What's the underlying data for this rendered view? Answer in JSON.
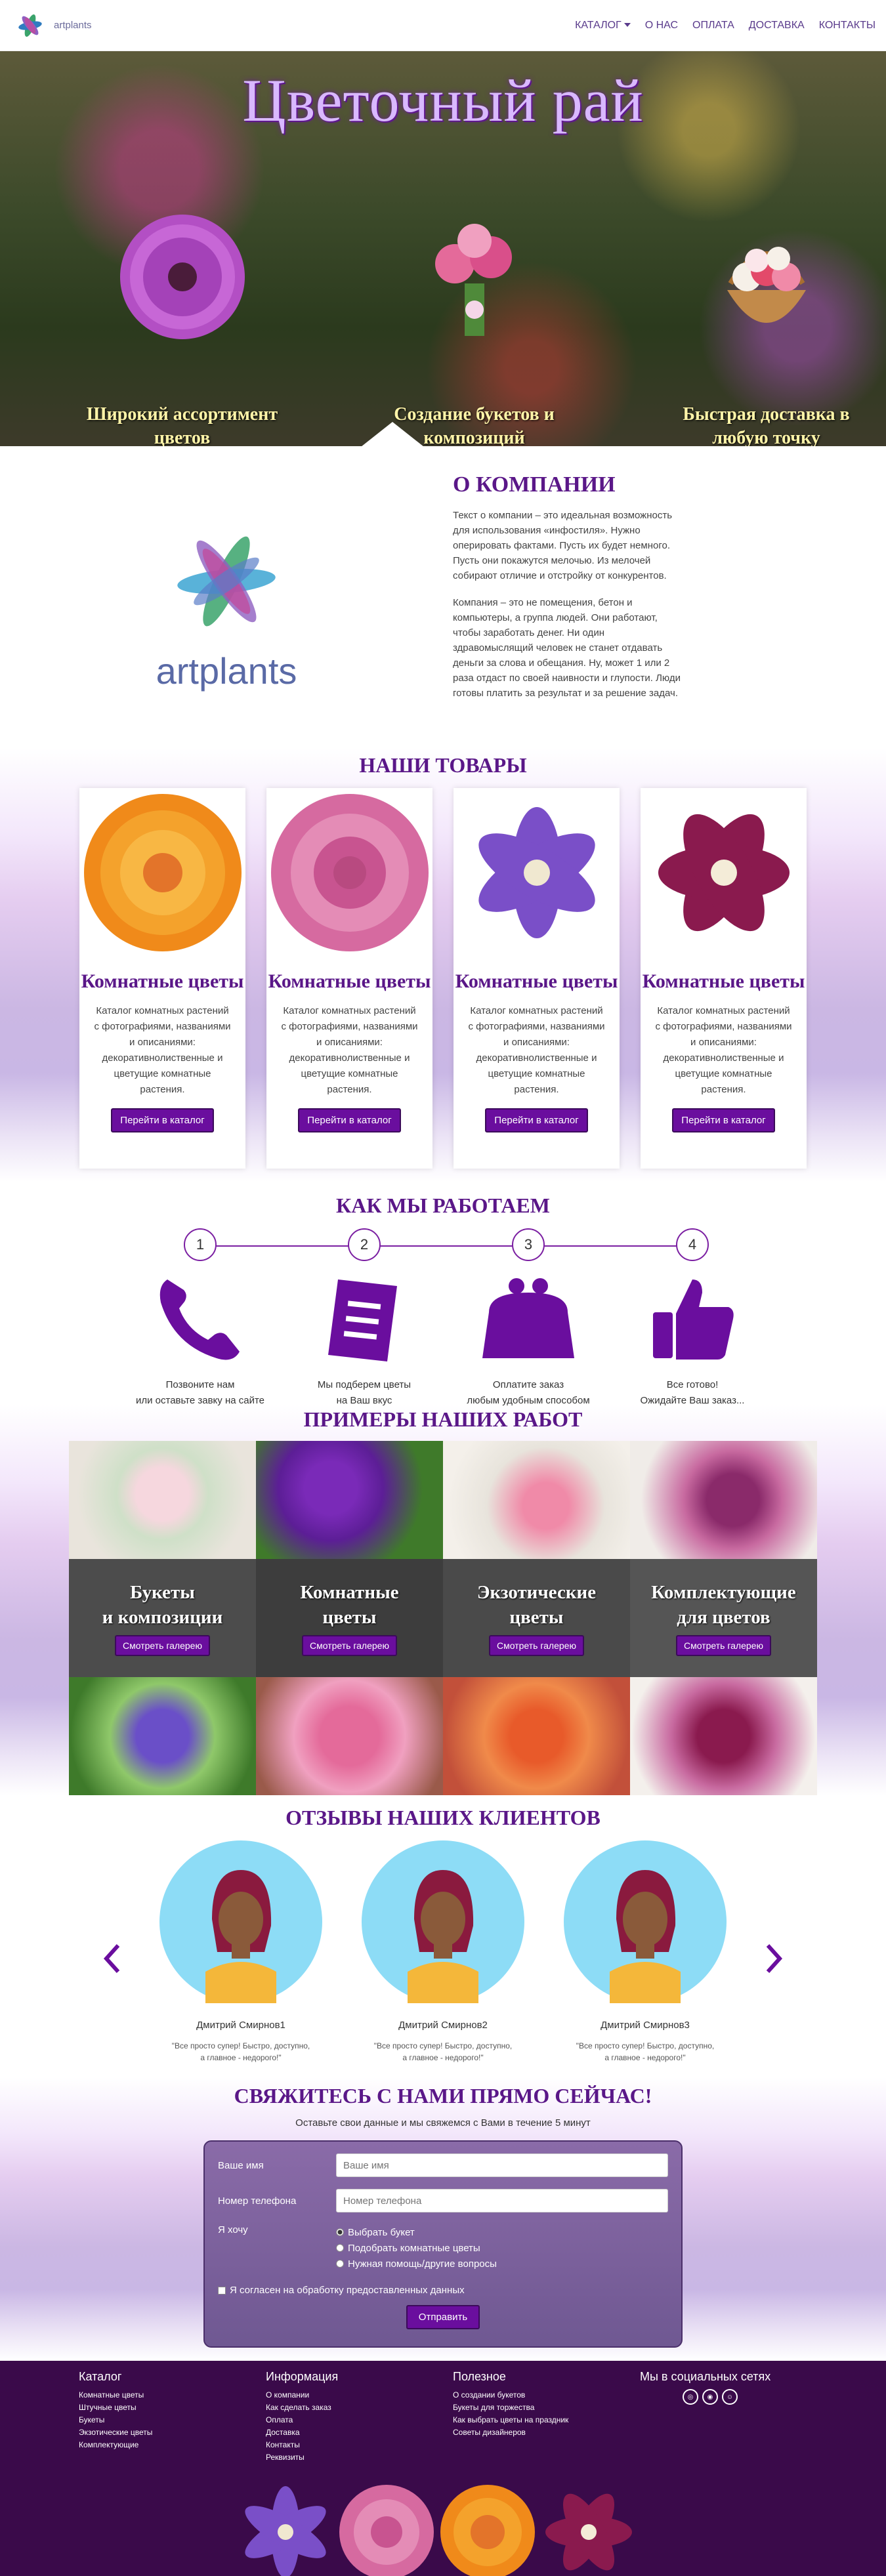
{
  "nav": {
    "brand": "artplants",
    "items": [
      "КАТАЛОГ",
      "О НАС",
      "ОПЛАТА",
      "ДОСТАВКА",
      "КОНТАКТЫ"
    ]
  },
  "hero": {
    "title": "Цветочный рай",
    "features": [
      "Широкий ассортимент цветов",
      "Создание букетов и композиций",
      "Быстрая доставка в любую точку"
    ]
  },
  "about": {
    "title": "О КОМПАНИИ",
    "logo_word": "artplants",
    "p1": "Текст о компании – это идеальная возможность для использования «инфостиля». Нужно оперировать фактами. Пусть их будет немного. Пусть они покажутся мелочью. Из мелочей собирают отличие и отстройку от конкурентов.",
    "p2": "Компания – это не помещения, бетон и компьютеры, а группа людей. Они работают, чтобы заработать денег. Ни один здравомыслящий человек не станет отдавать деньги за слова и обещания. Ну, может 1 или 2 раза отдаст по своей наивности и глупости. Люди готовы платить за результат и за решение задач."
  },
  "products": {
    "title": "НАШИ ТОВАРЫ",
    "items": [
      {
        "title": "Комнатные цветы",
        "text": "Каталог комнатных растений с фотографиями, названиями и описаниями: декоративнолиственные и цветущие комнатные растения.",
        "button": "Перейти в каталог"
      },
      {
        "title": "Комнатные цветы",
        "text": "Каталог комнатных растений с фотографиями, названиями и описаниями: декоративнолиственные и цветущие комнатные растения.",
        "button": "Перейти в каталог"
      },
      {
        "title": "Комнатные цветы",
        "text": "Каталог комнатных растений с фотографиями, названиями и описаниями: декоративнолиственные и цветущие комнатные растения.",
        "button": "Перейти в каталог"
      },
      {
        "title": "Комнатные цветы",
        "text": "Каталог комнатных растений с фотографиями, названиями и описаниями: декоративнолиственные и цветущие комнатные растения.",
        "button": "Перейти в каталог"
      }
    ]
  },
  "how": {
    "title": "КАК МЫ РАБОТАЕМ",
    "steps": [
      {
        "num": "1",
        "line1": "Позвоните нам",
        "line2": "или оставьте завку на сайте",
        "icon": "phone-icon"
      },
      {
        "num": "2",
        "line1": "Мы подберем цветы",
        "line2": "на Ваш вкус",
        "icon": "document-icon"
      },
      {
        "num": "3",
        "line1": "Оплатите заказ",
        "line2": "любым удобным способом",
        "icon": "purse-icon"
      },
      {
        "num": "4",
        "line1": "Все готово!",
        "line2": "Ожидайте Ваш заказ...",
        "icon": "thumbs-up-icon"
      }
    ]
  },
  "gallery": {
    "title": "ПРИМЕРЫ НАШИХ РАБОТ",
    "categories": [
      {
        "line1": "Букеты",
        "line2": "и композиции",
        "button": "Смотреть галерею"
      },
      {
        "line1": "Комнатные",
        "line2": "цветы",
        "button": "Смотреть галерею"
      },
      {
        "line1": "Экзотические",
        "line2": "цветы",
        "button": "Смотреть галерею"
      },
      {
        "line1": "Комплектующие",
        "line2": "для цветов",
        "button": "Смотреть галерею"
      }
    ]
  },
  "reviews": {
    "title": "ОТЗЫВЫ НАШИХ КЛИЕНТОВ",
    "items": [
      {
        "name": "Дмитрий Смирнов1",
        "q1": "\"Все просто супер! Быстро, доступно,",
        "q2": "а главное - недорого!\""
      },
      {
        "name": "Дмитрий Смирнов2",
        "q1": "\"Все просто супер! Быстро, доступно,",
        "q2": "а главное - недорого!\""
      },
      {
        "name": "Дмитрий Смирнов3",
        "q1": "\"Все просто супер! Быстро, доступно,",
        "q2": "а главное - недорого!\""
      }
    ]
  },
  "contact": {
    "title": "СВЯЖИТЕСЬ С НАМИ ПРЯМО СЕЙЧАС!",
    "subtitle": "Оставьте свои данные и мы свяжемся с Вами в течение 5 минут",
    "name_label": "Ваше имя",
    "name_placeholder": "Ваше имя",
    "phone_label": "Номер телефона",
    "phone_placeholder": "Номер телефона",
    "want_label": "Я хочу",
    "options": [
      "Выбрать букет",
      "Подобрать комнатные цветы",
      "Нужная помощь/другие вопросы"
    ],
    "agree": "Я согласен на обработку предоставленных данных",
    "submit": "Отправить"
  },
  "footer": {
    "catalog": {
      "title": "Каталог",
      "links": [
        "Комнатные цветы",
        "Штучные цветы",
        "Букеты",
        "Экзотические цветы",
        "Комплектующие"
      ]
    },
    "info": {
      "title": "Информация",
      "links": [
        "О компании",
        "Как сделать заказ",
        "Оплата",
        "Доставка",
        "Контакты",
        "Реквизиты"
      ]
    },
    "useful": {
      "title": "Полезное",
      "links": [
        "О создании букетов",
        "Букеты для торжества",
        "Как выбрать цветы на праздник",
        "Советы дизайнеров"
      ]
    },
    "social": {
      "title": "Мы в социальных сетях"
    }
  },
  "colors": {
    "accent": "#5a1788",
    "button": "#6a0e9e",
    "footer": "#3a0a4a"
  }
}
